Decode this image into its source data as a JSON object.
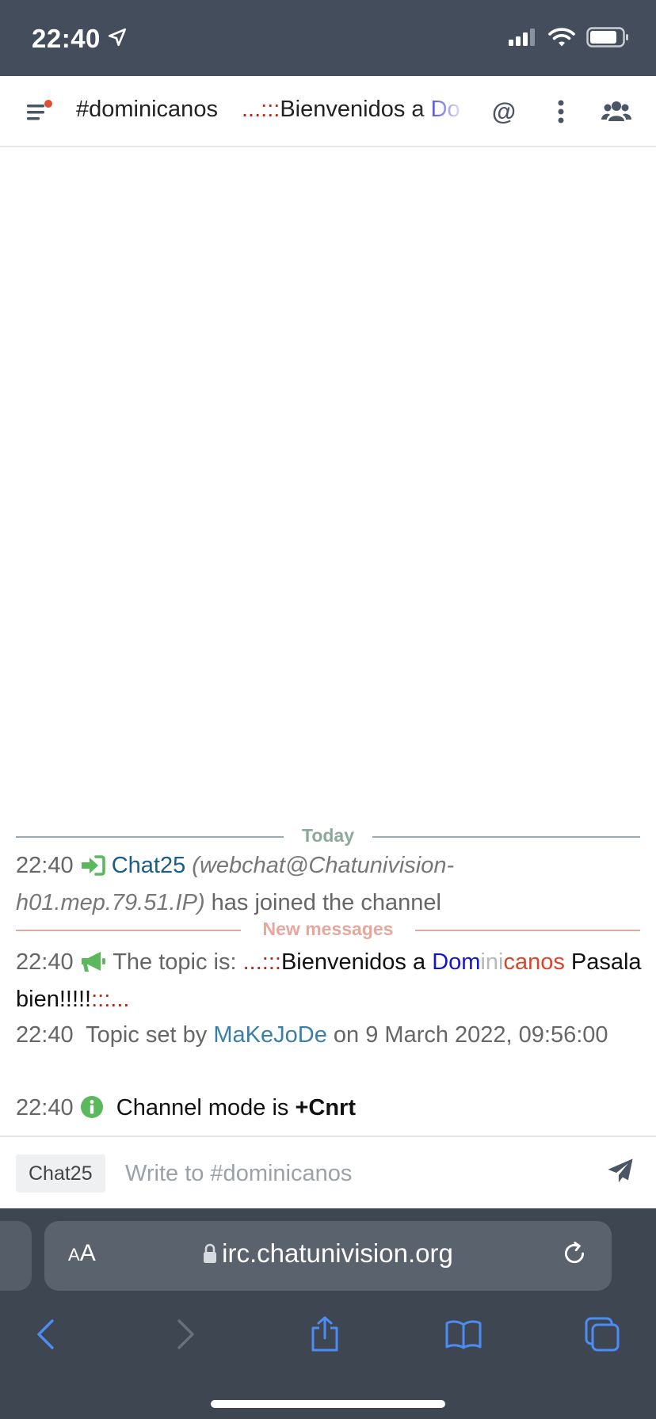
{
  "status_bar": {
    "time": "22:40"
  },
  "topbar": {
    "channel": "#dominicanos",
    "topic_preview": {
      "dots": "...:::",
      "text": "Bienvenidos a ",
      "blue_part": "Do"
    },
    "mention_label": "@"
  },
  "messages": {
    "today_divider": "Today",
    "new_divider": "New messages",
    "join": {
      "time": "22:40",
      "nick": "Chat25",
      "host": "(webchat@Chatunivision-h01.mep.79.51.IP)",
      "text": "has joined the channel"
    },
    "topic": {
      "time": "22:40",
      "prefix": "The topic is:",
      "dots": "...:::",
      "bienvenidos": "Bienvenidos a ",
      "dom": "Dom",
      "ini": "ini",
      "canos": "canos",
      "pasala": "Pasala bien!!!!!",
      "trailing": ":::..."
    },
    "topic_set": {
      "time": "22:40",
      "prefix": "Topic set by",
      "nick": "MaKeJoDe",
      "suffix": "on 9 March 2022, 09:56:00"
    },
    "mode": {
      "time": "22:40",
      "text": "Channel mode is",
      "mode": "+Cnrt"
    }
  },
  "input": {
    "nick": "Chat25",
    "placeholder": "Write to #dominicanos"
  },
  "browser": {
    "aa_label_small": "A",
    "aa_label_large": "A",
    "url": "irc.chatunivision.org"
  },
  "colors": {
    "status_bar_bg": "#434d5c",
    "accent_green": "#5cb85c",
    "nick_blue": "#1b5e84",
    "today_label": "#8aab9a",
    "new_messages_label": "#e6a89e",
    "browser_bg": "#3e4651",
    "safari_blue": "#4c8cf5"
  },
  "icons": [
    "location-arrow-icon",
    "signal-icon",
    "wifi-icon",
    "battery-icon",
    "menu-icon",
    "notification-dot",
    "kebab-menu-icon",
    "users-icon",
    "join-arrow-icon",
    "megaphone-icon",
    "info-icon",
    "send-icon",
    "lock-icon",
    "reload-icon",
    "back-icon",
    "forward-icon",
    "share-icon",
    "bookmarks-icon",
    "tabs-icon"
  ]
}
